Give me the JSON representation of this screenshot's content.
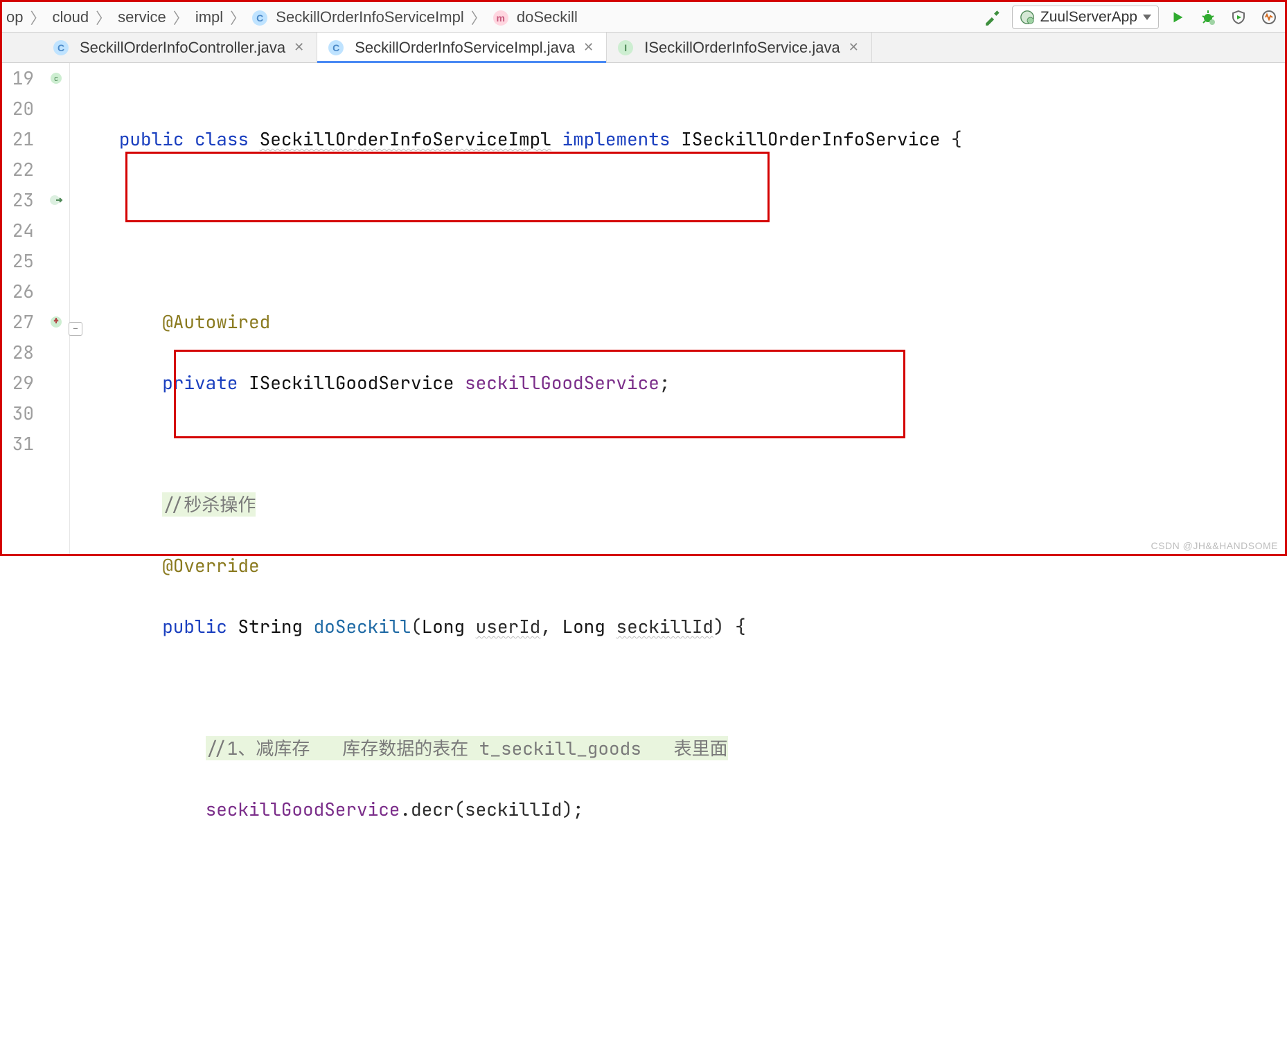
{
  "breadcrumb": {
    "items": [
      "op",
      "cloud",
      "service",
      "impl"
    ],
    "class_icon": "C",
    "class_name": "SeckillOrderInfoServiceImpl",
    "method_icon": "m",
    "method_name": "doSeckill"
  },
  "run_config": {
    "name": "ZuulServerApp"
  },
  "tabs": [
    {
      "icon": "C",
      "label": "SeckillOrderInfoController.java",
      "active": false
    },
    {
      "icon": "C",
      "label": "SeckillOrderInfoServiceImpl.java",
      "active": true
    },
    {
      "icon": "I",
      "label": "ISeckillOrderInfoService.java",
      "active": false
    }
  ],
  "gutter": {
    "lines": [
      "19",
      "20",
      "21",
      "22",
      "23",
      "24",
      "25",
      "26",
      "27",
      "28",
      "29",
      "30",
      "31"
    ]
  },
  "code": {
    "l19": {
      "kw_public": "public",
      "kw_class": "class",
      "name": "SeckillOrderInfoServiceImpl",
      "kw_impl": "implements",
      "iface": "ISeckillOrderInfoService",
      "brace": "{"
    },
    "l22": {
      "ann": "@Autowired"
    },
    "l23": {
      "kw": "private",
      "type": "ISeckillGoodService",
      "field": "seckillGoodService",
      "semi": ";"
    },
    "l25": {
      "cmt": "//秒杀操作"
    },
    "l26": {
      "ann": "@Override"
    },
    "l27": {
      "kw": "public",
      "ret": "String",
      "name": "doSeckill",
      "p1t": "Long",
      "p1n": "userId",
      "p2t": "Long",
      "p2n": "seckillId",
      "brace": ") {"
    },
    "l29": {
      "cmt": "//1、减库存   库存数据的表在 t_seckill_goods   表里面"
    },
    "l30": {
      "field": "seckillGoodService",
      "call": ".decr(seckillId);"
    }
  },
  "watermark": "CSDN @JH&&HANDSOME"
}
